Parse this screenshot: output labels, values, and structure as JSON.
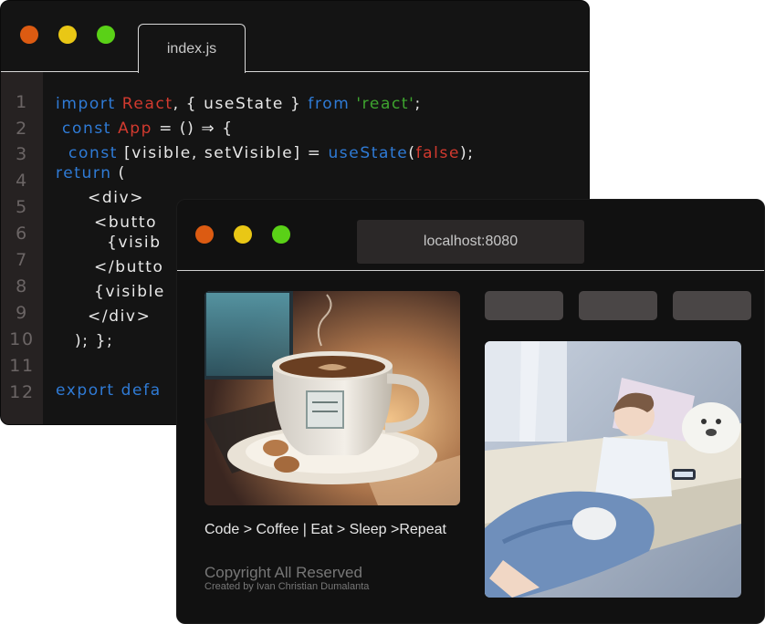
{
  "editor": {
    "tab_label": "index.js",
    "line_numbers": [
      "1",
      "2",
      "3",
      "4",
      "5",
      "6",
      "7",
      "8",
      "9",
      "10",
      "11",
      "12"
    ],
    "code": {
      "l1": {
        "a": "import ",
        "b": "React",
        "c": ", { useState } ",
        "d": "from ",
        "e": "'react'",
        "f": ";"
      },
      "l2": {
        "a": " const ",
        "b": "App",
        "c": " = () ⇒ {"
      },
      "l3": {
        "a": "  const ",
        "b": "[visible, setVisible] = ",
        "c": "useState",
        "d": "(",
        "e": "false",
        "f": ");"
      },
      "l4": {
        "a": "return",
        "b": " ("
      },
      "l5": "     <div>",
      "l6": "      <butto",
      "l7": "        {visib",
      "l8": "      </butto",
      "l9": "      {visible",
      "l10": "     </div>",
      "l11": "   ); };",
      "l12": "export defa"
    },
    "colors": {
      "red_dot": "#dc5b12",
      "yellow_dot": "#e9c715",
      "green_dot": "#5ad117",
      "keyword": "#2f7bd6",
      "identifier_red": "#d23a2f",
      "string_green": "#3ea42f"
    }
  },
  "browser": {
    "address": "localhost:8080",
    "caption": "Code > Coffee | Eat > Sleep >Repeat",
    "copyright": "Copyright All Reserved",
    "credit": "Created by Ivan Christian Dumalanta",
    "images": {
      "left": "coffee-cup-illustration",
      "right": "sleeping-boy-illustration"
    }
  }
}
